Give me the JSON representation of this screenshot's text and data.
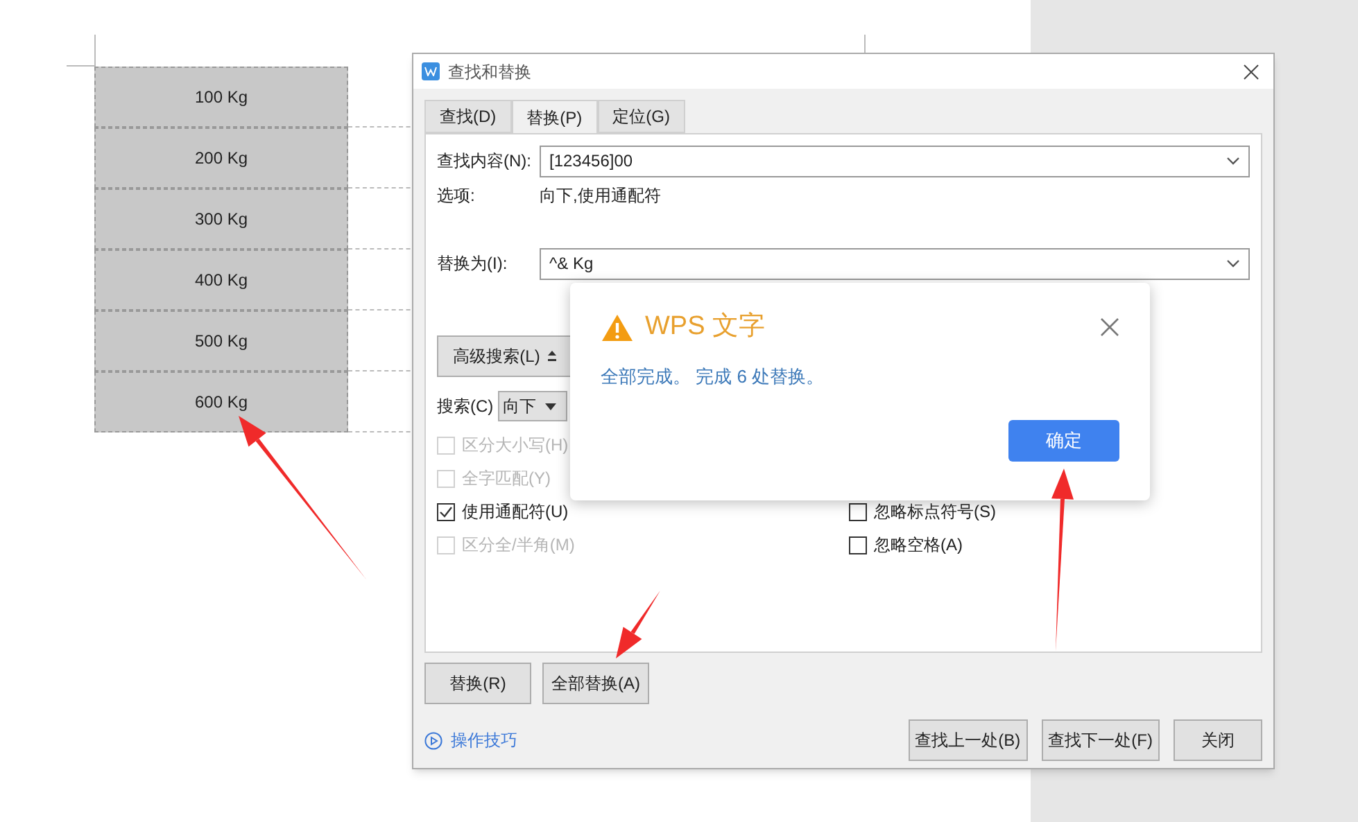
{
  "document": {
    "table_rows": [
      "100 Kg",
      "200 Kg",
      "300 Kg",
      "400 Kg",
      "500 Kg",
      "600 Kg"
    ]
  },
  "dialog": {
    "title": "查找和替换",
    "tabs": [
      {
        "label": "查找(D)",
        "selected": false
      },
      {
        "label": "替换(P)",
        "selected": true
      },
      {
        "label": "定位(G)",
        "selected": false
      }
    ],
    "find": {
      "label": "查找内容(N):",
      "value": "[123456]00"
    },
    "options": {
      "label": "选项:",
      "value": "向下,使用通配符"
    },
    "replace": {
      "label": "替换为(I):",
      "value": "^& Kg"
    },
    "advanced_button": "高级搜索(L)",
    "search": {
      "label": "搜索(C)",
      "direction": "向下"
    },
    "left_options": [
      {
        "label": "区分大小写(H)",
        "checked": false,
        "disabled": true
      },
      {
        "label": "全字匹配(Y)",
        "checked": false,
        "disabled": true
      },
      {
        "label": "使用通配符(U)",
        "checked": true,
        "disabled": false
      },
      {
        "label": "区分全/半角(M)",
        "checked": false,
        "disabled": true
      }
    ],
    "right_options": [
      {
        "label": "忽略标点符号(S)",
        "checked": false,
        "disabled": false
      },
      {
        "label": "忽略空格(A)",
        "checked": false,
        "disabled": false
      }
    ],
    "replace_buttons": [
      "替换(R)",
      "全部替换(A)"
    ],
    "tips_link": "操作技巧",
    "nav_buttons": [
      "查找上一处(B)",
      "查找下一处(F)",
      "关闭"
    ]
  },
  "popup": {
    "title": "WPS 文字",
    "message": "全部完成。 完成 6 处替换。",
    "ok_button": "确定"
  }
}
